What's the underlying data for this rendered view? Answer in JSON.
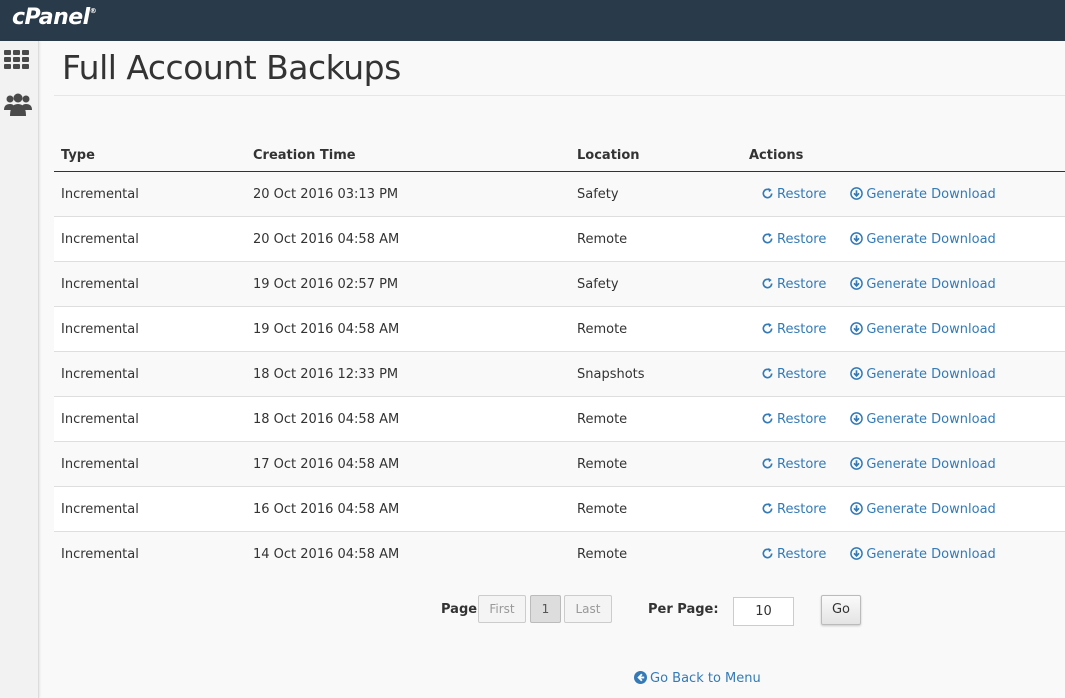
{
  "app": {
    "brand": "cPanel"
  },
  "page": {
    "title": "Full Account Backups"
  },
  "table": {
    "headers": [
      "Type",
      "Creation Time",
      "Location",
      "Actions"
    ],
    "actions": {
      "restore": "Restore",
      "download": "Generate Download"
    },
    "rows": [
      {
        "type": "Incremental",
        "time": "20 Oct 2016 03:13 PM",
        "location": "Safety"
      },
      {
        "type": "Incremental",
        "time": "20 Oct 2016 04:58 AM",
        "location": "Remote"
      },
      {
        "type": "Incremental",
        "time": "19 Oct 2016 02:57 PM",
        "location": "Safety"
      },
      {
        "type": "Incremental",
        "time": "19 Oct 2016 04:58 AM",
        "location": "Remote"
      },
      {
        "type": "Incremental",
        "time": "18 Oct 2016 12:33 PM",
        "location": "Snapshots"
      },
      {
        "type": "Incremental",
        "time": "18 Oct 2016 04:58 AM",
        "location": "Remote"
      },
      {
        "type": "Incremental",
        "time": "17 Oct 2016 04:58 AM",
        "location": "Remote"
      },
      {
        "type": "Incremental",
        "time": "16 Oct 2016 04:58 AM",
        "location": "Remote"
      },
      {
        "type": "Incremental",
        "time": "14 Oct 2016 04:58 AM",
        "location": "Remote"
      }
    ]
  },
  "pagination": {
    "page_label": "Page:",
    "first": "First",
    "current": "1",
    "last": "Last",
    "per_page_label": "Per Page:",
    "per_page_value": "10",
    "go": "Go"
  },
  "footer": {
    "back_link": "Go Back to Menu"
  },
  "colors": {
    "topbar": "#293a4a",
    "link": "#337ab7",
    "text": "#333333"
  },
  "icons": [
    "grid-icon",
    "users-icon",
    "refresh-icon",
    "download-circle-icon",
    "arrow-left-circle-icon"
  ]
}
